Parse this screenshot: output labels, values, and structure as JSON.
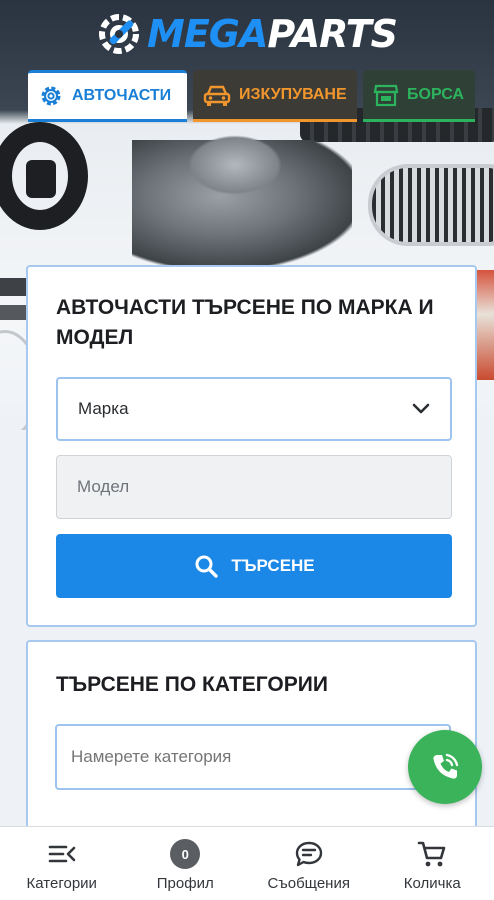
{
  "brand": {
    "logo_prefix": "MEGA",
    "logo_suffix": "PARTS"
  },
  "tabs": [
    {
      "label": "АВТОЧАСТИ",
      "icon": "gear-icon",
      "active": true,
      "color": "#1a7fd6"
    },
    {
      "label": "ИЗКУПУВАНЕ",
      "icon": "car-icon",
      "active": false,
      "color": "#f0962d"
    },
    {
      "label": "БОРСА",
      "icon": "store-icon",
      "active": false,
      "color": "#2cb35d"
    }
  ],
  "search_by_model": {
    "title": "АВТОЧАСТИ ТЪРСЕНЕ ПО МАРКА И МОДЕЛ",
    "make_value": "Марка",
    "model_placeholder": "Модел",
    "search_button": "ТЪРСЕНЕ"
  },
  "search_by_category": {
    "title": "ТЪРСЕНЕ ПО КАТЕГОРИИ",
    "placeholder": "Намерете категория"
  },
  "bottom_nav": [
    {
      "label": "Категории",
      "icon": "menu-arrow-icon"
    },
    {
      "label": "Профил",
      "icon": "profile-icon",
      "badge": "0"
    },
    {
      "label": "Съобщения",
      "icon": "chat-icon"
    },
    {
      "label": "Количка",
      "icon": "cart-icon"
    }
  ],
  "colors": {
    "accent": "#1b87e6",
    "call": "#3ab35a"
  }
}
